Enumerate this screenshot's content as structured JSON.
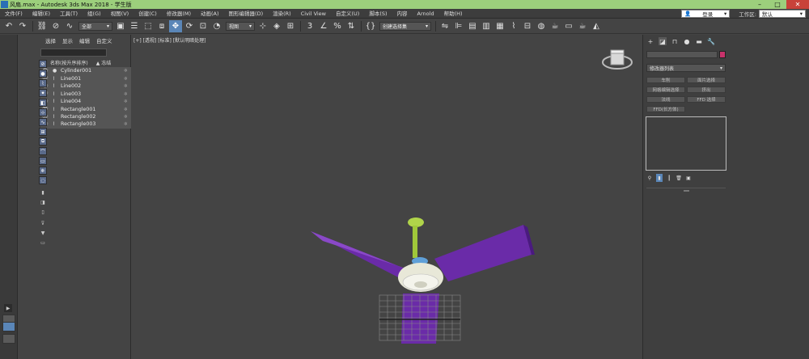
{
  "window": {
    "title": "风扇.max - Autodesk 3ds Max 2018 - 学生版",
    "minimize_icon": "minimize-icon",
    "maximize_icon": "maximize-icon",
    "close_icon": "close-icon"
  },
  "menu": {
    "items": [
      "文件(F)",
      "编辑(E)",
      "工具(T)",
      "组(G)",
      "视图(V)",
      "创建(C)",
      "修改器(M)",
      "动画(A)",
      "图形编辑器(D)",
      "渲染(R)",
      "Civil View",
      "自定义(U)",
      "脚本(S)",
      "内容",
      "Arnold",
      "帮助(H)"
    ],
    "login": "登录",
    "workspace_label": "工作区:",
    "workspace_value": "默认"
  },
  "toolbar": {
    "selection_filter": "全部",
    "reference_coord": "视图",
    "named_selection": "创建选择集"
  },
  "scene_explorer": {
    "tabs": [
      "选择",
      "显示",
      "编辑",
      "自定义"
    ],
    "column_name": "名称(按升序排序)",
    "column_frozen": "▲ 冻结",
    "objects": [
      {
        "name": "Cylinder001",
        "type": "geometry-icon"
      },
      {
        "name": "Line001",
        "type": "shape-icon"
      },
      {
        "name": "Line002",
        "type": "shape-icon"
      },
      {
        "name": "Line003",
        "type": "shape-icon"
      },
      {
        "name": "Line004",
        "type": "shape-icon"
      },
      {
        "name": "Rectangle001",
        "type": "shape-icon"
      },
      {
        "name": "Rectangle002",
        "type": "shape-icon"
      },
      {
        "name": "Rectangle003",
        "type": "shape-icon"
      }
    ]
  },
  "viewport": {
    "label": "[+] [透视] [标准] [默认明暗处理]"
  },
  "command_panel": {
    "modifier_list": "修改器列表",
    "buttons": [
      "车削",
      "面片选择",
      "网格编辑选择",
      "挤出",
      "法线",
      "FFD 选择",
      "FFD(长方体)"
    ]
  },
  "colors": {
    "accent": "#5a86b8",
    "title_bar": "#9ccf7c",
    "object_color": "#c8326b",
    "blade": "#6a2ba8",
    "rod": "#b0d44a"
  }
}
